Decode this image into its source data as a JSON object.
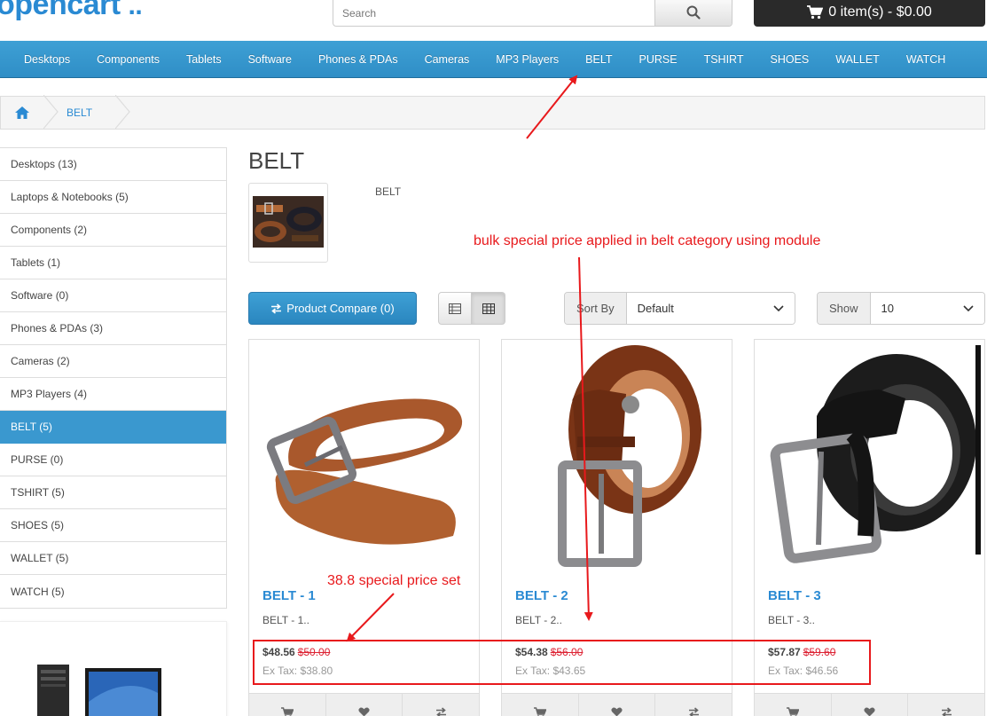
{
  "header": {
    "logo_text": "opencart",
    "logo_dots": "..",
    "search_placeholder": "Search",
    "cart_label": "0 item(s) - $0.00"
  },
  "nav": {
    "items": [
      "Desktops",
      "Components",
      "Tablets",
      "Software",
      "Phones & PDAs",
      "Cameras",
      "MP3 Players",
      "BELT",
      "PURSE",
      "TSHIRT",
      "SHOES",
      "WALLET",
      "WATCH"
    ]
  },
  "breadcrumb": {
    "current": "BELT"
  },
  "sidebar": {
    "items": [
      {
        "label": "Desktops (13)",
        "active": false
      },
      {
        "label": "Laptops & Notebooks (5)",
        "active": false
      },
      {
        "label": "Components (2)",
        "active": false
      },
      {
        "label": "Tablets (1)",
        "active": false
      },
      {
        "label": "Software (0)",
        "active": false
      },
      {
        "label": "Phones & PDAs (3)",
        "active": false
      },
      {
        "label": "Cameras (2)",
        "active": false
      },
      {
        "label": "MP3 Players (4)",
        "active": false
      },
      {
        "label": "BELT (5)",
        "active": true
      },
      {
        "label": "PURSE (0)",
        "active": false
      },
      {
        "label": "TSHIRT (5)",
        "active": false
      },
      {
        "label": "SHOES (5)",
        "active": false
      },
      {
        "label": "WALLET (5)",
        "active": false
      },
      {
        "label": "WATCH (5)",
        "active": false
      }
    ]
  },
  "category": {
    "title": "BELT",
    "description": "BELT"
  },
  "toolbar": {
    "compare_label": "Product Compare (0)",
    "sort_label": "Sort By",
    "sort_value": "Default",
    "show_label": "Show",
    "show_value": "10"
  },
  "products": [
    {
      "name": "BELT - 1",
      "desc": "BELT - 1..",
      "price": "$48.56",
      "old_price": "$50.00",
      "ex_tax": "Ex Tax: $38.80",
      "color": "#a9582c"
    },
    {
      "name": "BELT - 2",
      "desc": "BELT - 2..",
      "price": "$54.38",
      "old_price": "$56.00",
      "ex_tax": "Ex Tax: $43.65",
      "color": "#7a3416"
    },
    {
      "name": "BELT - 3",
      "desc": "BELT - 3..",
      "price": "$57.87",
      "old_price": "$59.60",
      "ex_tax": "Ex Tax: $46.56",
      "color": "#1c1c1c"
    }
  ],
  "annotations": {
    "bulk": "bulk special price applied in belt category using module",
    "special": "38.8 special price set",
    "color": "#e8191c"
  },
  "colors": {
    "accent": "#2a8ad3",
    "nav": "#3a98cf",
    "old_price": "#dd2233"
  }
}
